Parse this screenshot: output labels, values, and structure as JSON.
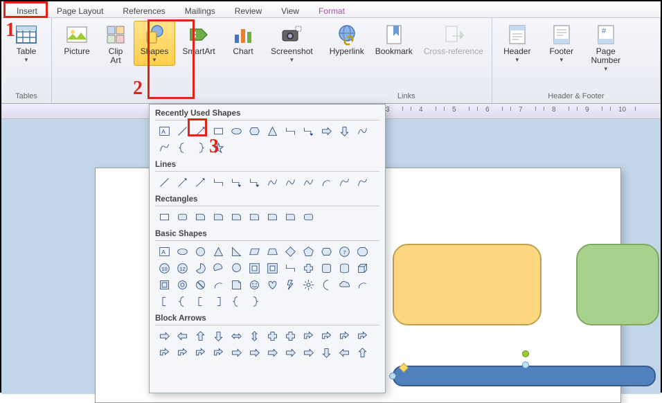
{
  "tabs": {
    "insert": "Insert",
    "page_layout": "Page Layout",
    "references": "References",
    "mailings": "Mailings",
    "review": "Review",
    "view": "View",
    "format": "Format"
  },
  "ribbon": {
    "tables": {
      "label": "Tables",
      "table": "Table"
    },
    "illustrations": {
      "picture": "Picture",
      "clipart": "Clip\nArt",
      "shapes": "Shapes",
      "smartart": "SmartArt",
      "chart": "Chart",
      "screenshot": "Screenshot"
    },
    "links": {
      "label": "Links",
      "hyperlink": "Hyperlink",
      "bookmark": "Bookmark",
      "crossref": "Cross-reference"
    },
    "hf": {
      "label": "Header & Footer",
      "header": "Header",
      "footer": "Footer",
      "pagenum": "Page\nNumber"
    }
  },
  "gallery": {
    "recent": "Recently Used Shapes",
    "lines": "Lines",
    "rects": "Rectangles",
    "basic": "Basic Shapes",
    "block": "Block Arrows"
  },
  "ruler_ticks": [
    3,
    4,
    5,
    6,
    7,
    8,
    9,
    10
  ],
  "annotations": {
    "n1": "1",
    "n2": "2",
    "n3": "3"
  }
}
